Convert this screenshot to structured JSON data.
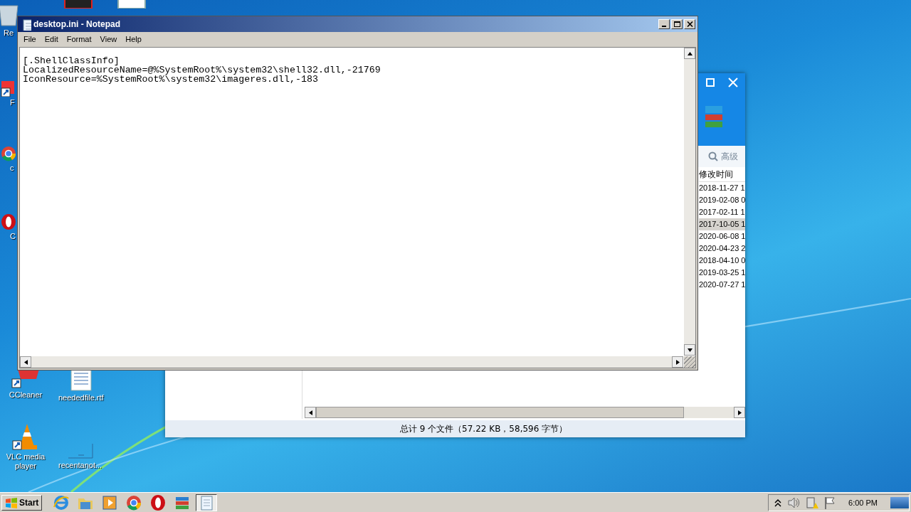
{
  "desktop_icons": [
    {
      "kind": "recycle",
      "label": "Re"
    },
    {
      "kind": "shortcut",
      "label": "F"
    },
    {
      "kind": "chrome",
      "label": "c"
    },
    {
      "kind": "opera",
      "label": "C"
    },
    {
      "kind": "ccleaner",
      "label": "CCleaner"
    },
    {
      "kind": "document",
      "label": "neededfile.rtf"
    },
    {
      "kind": "vlc",
      "label": "VLC media player"
    },
    {
      "kind": "blank",
      "label": "recentanot..."
    }
  ],
  "archive_window": {
    "search_button": "高级",
    "column_header": "修改时间",
    "rows": [
      {
        "date": "2018-11-27 1",
        "selected": false
      },
      {
        "date": "2019-02-08 0",
        "selected": false
      },
      {
        "date": "2017-02-11 1",
        "selected": false
      },
      {
        "date": "2017-10-05 1",
        "selected": true
      },
      {
        "date": "2020-06-08 1",
        "selected": false
      },
      {
        "date": "2020-04-23 2",
        "selected": false
      },
      {
        "date": "2018-04-10 0",
        "selected": false
      },
      {
        "date": "2019-03-25 1",
        "selected": false
      },
      {
        "date": "2020-07-27 1",
        "selected": false
      }
    ],
    "status": "总计 9 个文件（57.22 KB，58,596 字节）"
  },
  "notepad": {
    "title": "desktop.ini - Notepad",
    "menu": [
      "File",
      "Edit",
      "Format",
      "View",
      "Help"
    ],
    "lines": [
      "[.ShellClassInfo]",
      "LocalizedResourceName=@%SystemRoot%\\system32\\shell32.dll,-21769",
      "IconResource=%SystemRoot%\\system32\\imageres.dll,-183"
    ]
  },
  "taskbar": {
    "start": "Start",
    "buttons": [
      {
        "kind": "ie",
        "selected": false
      },
      {
        "kind": "folder",
        "selected": false
      },
      {
        "kind": "media",
        "selected": false
      },
      {
        "kind": "chrome",
        "selected": false
      },
      {
        "kind": "opera",
        "selected": false
      },
      {
        "kind": "archive",
        "selected": false
      },
      {
        "kind": "notepad",
        "selected": true
      }
    ],
    "clock": "6:00 PM"
  }
}
